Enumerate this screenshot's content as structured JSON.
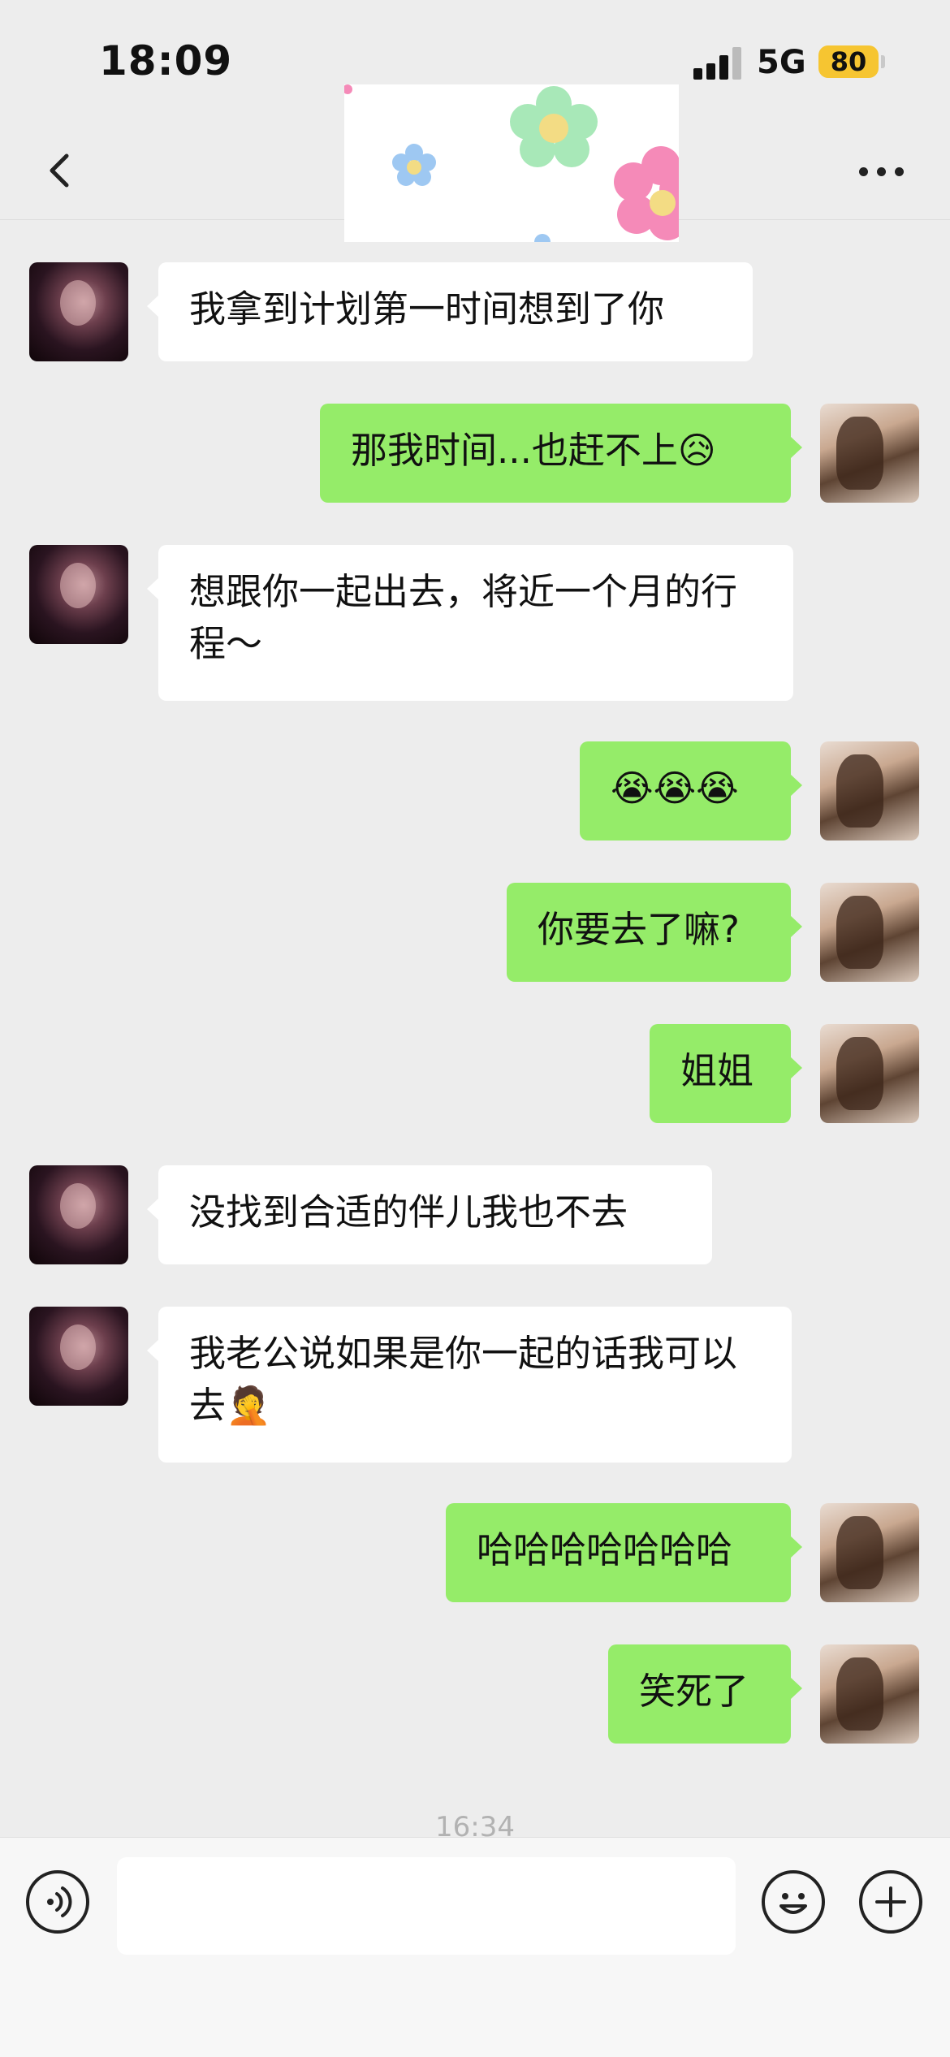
{
  "status_bar": {
    "time": "18:09",
    "network": "5G",
    "battery": "80"
  },
  "nav": {
    "back_icon": "chevron-left-icon",
    "more_icon": "ellipsis-icon"
  },
  "messages": [
    {
      "side": "left",
      "text": "我拿到计划第一时间想到了你"
    },
    {
      "side": "right",
      "text": "那我时间...也赶不上😥"
    },
    {
      "side": "left",
      "text": "想跟你一起出去，将近一个月的行程～"
    },
    {
      "side": "right",
      "text": "😭😭😭"
    },
    {
      "side": "right",
      "text": "你要去了嘛?"
    },
    {
      "side": "right",
      "text": "姐姐"
    },
    {
      "side": "left",
      "text": "没找到合适的伴儿我也不去"
    },
    {
      "side": "left",
      "text": "我老公说如果是你一起的话我可以去🤦"
    },
    {
      "side": "right",
      "text": "哈哈哈哈哈哈哈"
    },
    {
      "side": "right",
      "text": "笑死了"
    }
  ],
  "time_separator": "16:34",
  "input_bar": {
    "placeholder": "",
    "value": ""
  },
  "colors": {
    "background": "#ededed",
    "outgoing_bubble": "#95ec69",
    "incoming_bubble": "#ffffff",
    "battery": "#f6c531"
  }
}
